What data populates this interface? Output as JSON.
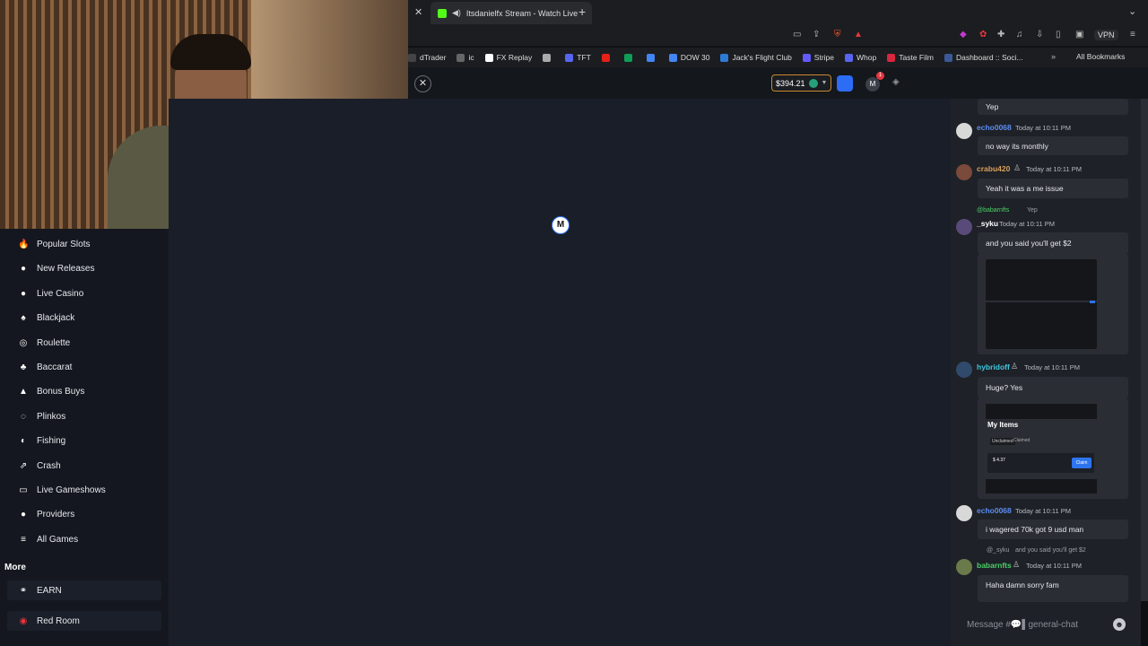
{
  "browser": {
    "tab_title": "Itsdanielfx Stream - Watch Live",
    "tab_close": "✕",
    "new_tab": "+",
    "tab_menu": "⌄",
    "vpn_label": "VPN",
    "bookmarks": [
      {
        "label": "dTrader",
        "color": "#444"
      },
      {
        "label": "ic",
        "color": "#666"
      },
      {
        "label": "FX Replay",
        "color": "#fff"
      },
      {
        "label": "",
        "color": "#aaa"
      },
      {
        "label": "TFT",
        "color": "#5865f2"
      },
      {
        "label": "",
        "color": "#e62117"
      },
      {
        "label": "",
        "color": "#0f9d58"
      },
      {
        "label": "",
        "color": "#4285f4"
      },
      {
        "label": "DOW 30",
        "color": "#4285f4"
      },
      {
        "label": "Jack's Flight Club",
        "color": "#2e7bd6"
      },
      {
        "label": "Stripe",
        "color": "#635bff"
      },
      {
        "label": "Whop",
        "color": "#5865f2"
      },
      {
        "label": "Taste Film",
        "color": "#d7263d"
      },
      {
        "label": "Dashboard :: Soci...",
        "color": "#3b5998"
      }
    ],
    "all_bookmarks": "All Bookmarks"
  },
  "header": {
    "close_symbol": "✕",
    "balance": "$394.21",
    "notification_count": "1",
    "avatar_letter": "M"
  },
  "loader_letter": "M",
  "sidebar": {
    "items": [
      {
        "label": "Popular Slots",
        "icon": "flame-icon",
        "glyph": "🔥"
      },
      {
        "label": "New Releases",
        "icon": "person-icon",
        "glyph": "●"
      },
      {
        "label": "Live Casino",
        "icon": "person-icon",
        "glyph": "●"
      },
      {
        "label": "Blackjack",
        "icon": "spade-icon",
        "glyph": "♠"
      },
      {
        "label": "Roulette",
        "icon": "roulette-icon",
        "glyph": "◎"
      },
      {
        "label": "Baccarat",
        "icon": "club-icon",
        "glyph": "♣"
      },
      {
        "label": "Bonus Buys",
        "icon": "bag-icon",
        "glyph": "▲"
      },
      {
        "label": "Plinkos",
        "icon": "dot-icon",
        "glyph": "◌"
      },
      {
        "label": "Fishing",
        "icon": "fish-icon",
        "glyph": "◐"
      },
      {
        "label": "Crash",
        "icon": "rocket-icon",
        "glyph": "⇗"
      },
      {
        "label": "Live Gameshows",
        "icon": "screen-icon",
        "glyph": "▭"
      },
      {
        "label": "Providers",
        "icon": "person-icon",
        "glyph": "●"
      },
      {
        "label": "All Games",
        "icon": "stack-icon",
        "glyph": "≡"
      }
    ],
    "more_title": "More",
    "more_items": [
      {
        "label": "EARN",
        "icon": "link-icon",
        "glyph": "⚭"
      },
      {
        "label": "Red Room",
        "icon": "lips-icon",
        "glyph": "◉"
      }
    ]
  },
  "chat": {
    "top_message": "Yep",
    "messages": [
      {
        "user": "echo0068",
        "color": "#5b8def",
        "time": "Today at 10:11 PM",
        "text": "no way its monthly"
      },
      {
        "user": "crabu420",
        "color": "#d9a05b",
        "time": "Today at 10:11 PM",
        "text": "Yeah it was a me issue"
      },
      {
        "reply_user": "@babarnfts",
        "reply_text": "Yep",
        "user": "_syku",
        "color": "#ffffff",
        "time": "Today at 10:11 PM",
        "text": "and you said you'll get $2"
      },
      {
        "user": "hybridoff",
        "color": "#3ec7e0",
        "time": "Today at 10:11 PM",
        "text": "Huge? Yes",
        "embed_title": "My Items",
        "embed_tabs": [
          "Unclaimed",
          "Claimed"
        ],
        "embed_item": "$ 4.37",
        "embed_button": "Claim"
      },
      {
        "user": "echo0068",
        "color": "#5b8def",
        "time": "Today at 10:11 PM",
        "text": "i wagered 70k got 9 usd man"
      },
      {
        "reply_user": "@_syku",
        "reply_text": "and you said you'll get $2",
        "user": "babarnfts",
        "color": "#4bd068",
        "time": "Today at 10:11 PM",
        "text": "Haha damn sorry fam"
      }
    ],
    "input_placeholder": "Message #💬▌general-chat",
    "emoji_symbol": "☻"
  }
}
